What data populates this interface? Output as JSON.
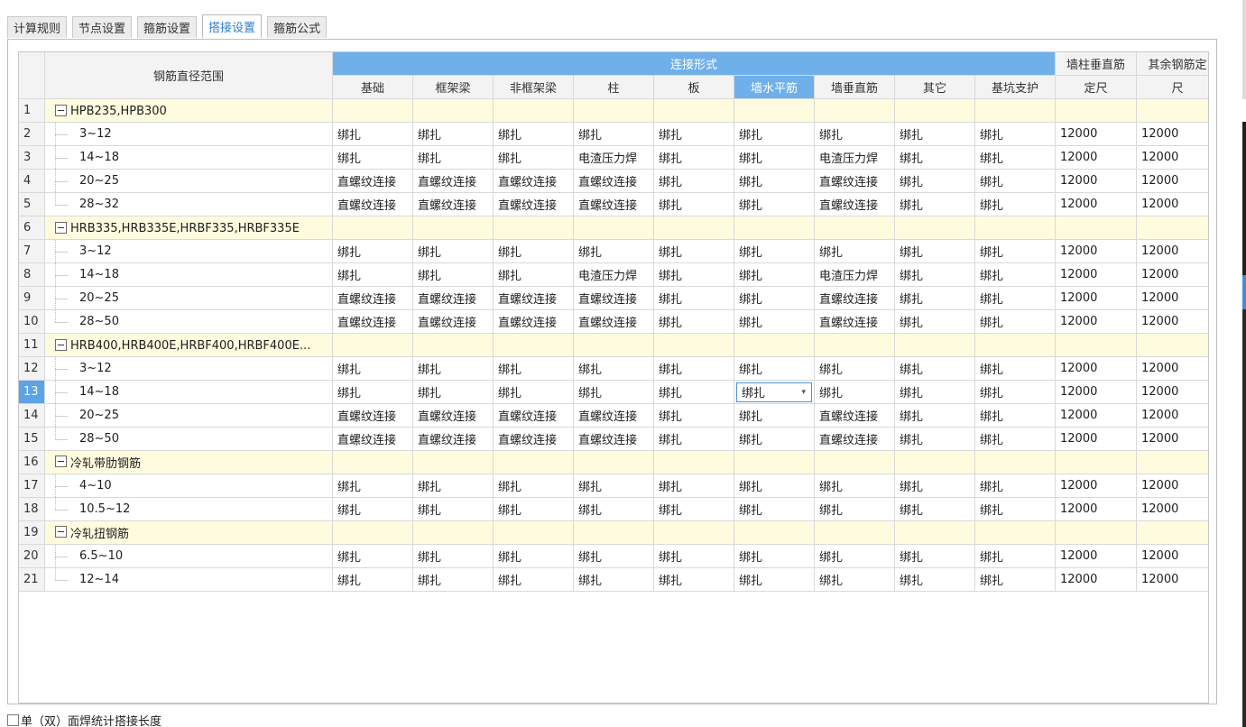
{
  "tabs": [
    {
      "label": "计算规则",
      "active": false
    },
    {
      "label": "节点设置",
      "active": false
    },
    {
      "label": "箍筋设置",
      "active": false
    },
    {
      "label": "搭接设置",
      "active": true
    },
    {
      "label": "箍筋公式",
      "active": false
    }
  ],
  "grid": {
    "range_header": "钢筋直径范围",
    "group_header": "连接形式",
    "sub_headers": [
      "基础",
      "框架梁",
      "非框架梁",
      "柱",
      "板",
      "墙水平筋",
      "墙垂直筋",
      "其它",
      "基坑支护"
    ],
    "selected_sub_header_index": 5,
    "length_header_1": {
      "line1": "墙柱垂直筋",
      "line2": "定尺"
    },
    "length_header_2": {
      "line1": "其余钢筋定",
      "line2": "尺"
    },
    "rows": [
      {
        "n": "1",
        "type": "group",
        "label": "HPB235,HPB300"
      },
      {
        "n": "2",
        "type": "item",
        "range": "3~12",
        "cells": [
          "绑扎",
          "绑扎",
          "绑扎",
          "绑扎",
          "绑扎",
          "绑扎",
          "绑扎",
          "绑扎",
          "绑扎"
        ],
        "len1": "12000",
        "len2": "12000"
      },
      {
        "n": "3",
        "type": "item",
        "range": "14~18",
        "cells": [
          "绑扎",
          "绑扎",
          "绑扎",
          "电渣压力焊",
          "绑扎",
          "绑扎",
          "电渣压力焊",
          "绑扎",
          "绑扎"
        ],
        "len1": "12000",
        "len2": "12000"
      },
      {
        "n": "4",
        "type": "item",
        "range": "20~25",
        "cells": [
          "直螺纹连接",
          "直螺纹连接",
          "直螺纹连接",
          "直螺纹连接",
          "绑扎",
          "绑扎",
          "直螺纹连接",
          "绑扎",
          "绑扎"
        ],
        "len1": "12000",
        "len2": "12000"
      },
      {
        "n": "5",
        "type": "item",
        "last": true,
        "range": "28~32",
        "cells": [
          "直螺纹连接",
          "直螺纹连接",
          "直螺纹连接",
          "直螺纹连接",
          "绑扎",
          "绑扎",
          "直螺纹连接",
          "绑扎",
          "绑扎"
        ],
        "len1": "12000",
        "len2": "12000"
      },
      {
        "n": "6",
        "type": "group",
        "label": "HRB335,HRB335E,HRBF335,HRBF335E"
      },
      {
        "n": "7",
        "type": "item",
        "range": "3~12",
        "cells": [
          "绑扎",
          "绑扎",
          "绑扎",
          "绑扎",
          "绑扎",
          "绑扎",
          "绑扎",
          "绑扎",
          "绑扎"
        ],
        "len1": "12000",
        "len2": "12000"
      },
      {
        "n": "8",
        "type": "item",
        "range": "14~18",
        "cells": [
          "绑扎",
          "绑扎",
          "绑扎",
          "电渣压力焊",
          "绑扎",
          "绑扎",
          "电渣压力焊",
          "绑扎",
          "绑扎"
        ],
        "len1": "12000",
        "len2": "12000"
      },
      {
        "n": "9",
        "type": "item",
        "range": "20~25",
        "cells": [
          "直螺纹连接",
          "直螺纹连接",
          "直螺纹连接",
          "直螺纹连接",
          "绑扎",
          "绑扎",
          "直螺纹连接",
          "绑扎",
          "绑扎"
        ],
        "len1": "12000",
        "len2": "12000"
      },
      {
        "n": "10",
        "type": "item",
        "last": true,
        "range": "28~50",
        "cells": [
          "直螺纹连接",
          "直螺纹连接",
          "直螺纹连接",
          "直螺纹连接",
          "绑扎",
          "绑扎",
          "直螺纹连接",
          "绑扎",
          "绑扎"
        ],
        "len1": "12000",
        "len2": "12000"
      },
      {
        "n": "11",
        "type": "group",
        "label": "HRB400,HRB400E,HRBF400,HRBF400E..."
      },
      {
        "n": "12",
        "type": "item",
        "range": "3~12",
        "cells": [
          "绑扎",
          "绑扎",
          "绑扎",
          "绑扎",
          "绑扎",
          "绑扎",
          "绑扎",
          "绑扎",
          "绑扎"
        ],
        "len1": "12000",
        "len2": "12000"
      },
      {
        "n": "13",
        "type": "item",
        "selected": true,
        "range": "14~18",
        "cells": [
          "绑扎",
          "绑扎",
          "绑扎",
          "绑扎",
          "绑扎",
          "绑扎",
          "绑扎",
          "绑扎",
          "绑扎"
        ],
        "len1": "12000",
        "len2": "12000"
      },
      {
        "n": "14",
        "type": "item",
        "range": "20~25",
        "cells": [
          "直螺纹连接",
          "直螺纹连接",
          "直螺纹连接",
          "直螺纹连接",
          "绑扎",
          "绑扎",
          "直螺纹连接",
          "绑扎",
          "绑扎"
        ],
        "len1": "12000",
        "len2": "12000"
      },
      {
        "n": "15",
        "type": "item",
        "last": true,
        "range": "28~50",
        "cells": [
          "直螺纹连接",
          "直螺纹连接",
          "直螺纹连接",
          "直螺纹连接",
          "绑扎",
          "绑扎",
          "直螺纹连接",
          "绑扎",
          "绑扎"
        ],
        "len1": "12000",
        "len2": "12000"
      },
      {
        "n": "16",
        "type": "group",
        "label": "冷轧带肋钢筋"
      },
      {
        "n": "17",
        "type": "item",
        "range": "4~10",
        "cells": [
          "绑扎",
          "绑扎",
          "绑扎",
          "绑扎",
          "绑扎",
          "绑扎",
          "绑扎",
          "绑扎",
          "绑扎"
        ],
        "len1": "12000",
        "len2": "12000"
      },
      {
        "n": "18",
        "type": "item",
        "last": true,
        "range": "10.5~12",
        "cells": [
          "绑扎",
          "绑扎",
          "绑扎",
          "绑扎",
          "绑扎",
          "绑扎",
          "绑扎",
          "绑扎",
          "绑扎"
        ],
        "len1": "12000",
        "len2": "12000"
      },
      {
        "n": "19",
        "type": "group",
        "label": "冷轧扭钢筋"
      },
      {
        "n": "20",
        "type": "item",
        "range": "6.5~10",
        "cells": [
          "绑扎",
          "绑扎",
          "绑扎",
          "绑扎",
          "绑扎",
          "绑扎",
          "绑扎",
          "绑扎",
          "绑扎"
        ],
        "len1": "12000",
        "len2": "12000"
      },
      {
        "n": "21",
        "type": "item",
        "last": true,
        "range": "12~14",
        "cells": [
          "绑扎",
          "绑扎",
          "绑扎",
          "绑扎",
          "绑扎",
          "绑扎",
          "绑扎",
          "绑扎",
          "绑扎"
        ],
        "len1": "12000",
        "len2": "12000"
      }
    ],
    "editing_cell": {
      "row": "13",
      "col": 5,
      "value": "绑扎"
    }
  },
  "footer": {
    "checkbox_label": "单（双）面焊统计搭接长度",
    "checked": false
  },
  "colors": {
    "accent": "#6fb0ea",
    "group_row": "#fffbdf",
    "active_tab_text": "#2d7fd0"
  }
}
